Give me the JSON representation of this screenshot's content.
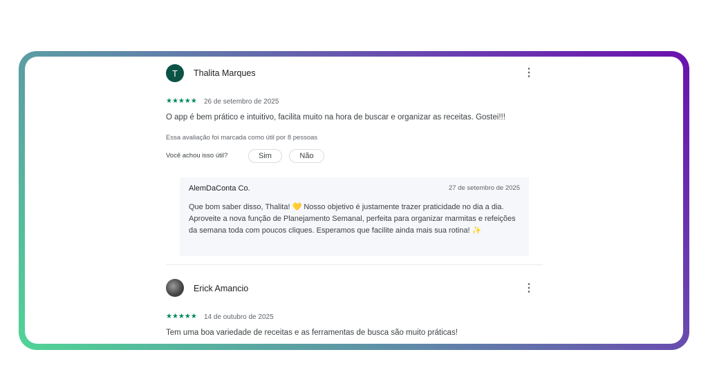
{
  "reviews": [
    {
      "author": "Thalita Marques",
      "initial": "T",
      "stars": "★★★★★",
      "date": "26 de setembro de 2025",
      "text": "O app é bem prático e intuitivo, facilita muito na hora de buscar e organizar as receitas. Gostei!!!",
      "helpful_count": "Essa avaliação foi marcada como útil por 8 pessoas",
      "helpful_question": "Você achou isso útil?",
      "yes_label": "Sim",
      "no_label": "Não",
      "reply": {
        "developer": "AlemDaConta Co.",
        "date": "27 de setembro de 2025",
        "text": "Que bom saber disso, Thalita! 💛 Nosso objetivo é justamente trazer praticidade no dia a dia. Aproveite a nova função de Planejamento Semanal, perfeita para organizar marmitas e refeições da semana toda com poucos cliques. Esperamos que facilite ainda mais sua rotina! ✨"
      }
    },
    {
      "author": "Erick Amancio",
      "stars": "★★★★★",
      "date": "14 de outubro de 2025",
      "text": "Tem uma boa variedade de receitas e as ferramentas de busca são muito práticas!"
    }
  ],
  "icons": {
    "more": "more-vert-icon",
    "star": "star-icon"
  },
  "colors": {
    "star": "#01875f",
    "avatar": "#0b5345",
    "frame_start": "#50d496",
    "frame_end": "#6a11ad"
  }
}
